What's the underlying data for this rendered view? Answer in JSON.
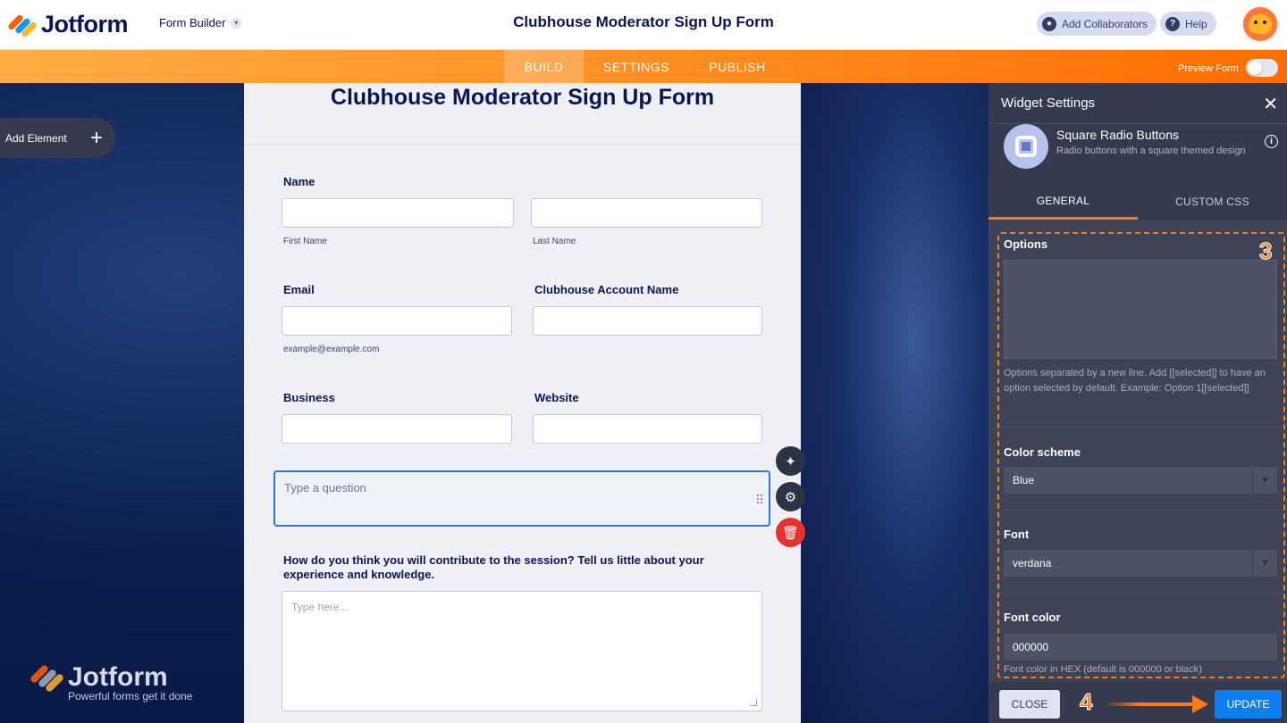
{
  "header": {
    "logo_text": "Jotform",
    "builder_label": "Form Builder",
    "form_title": "Clubhouse Moderator Sign Up Form",
    "add_collaborators": "Add Collaborators",
    "help": "Help"
  },
  "nav": {
    "tabs": [
      "BUILD",
      "SETTINGS",
      "PUBLISH"
    ],
    "active_tab": "BUILD",
    "preview_label": "Preview Form"
  },
  "canvas": {
    "add_element": "Add Element",
    "watermark_text": "Jotform",
    "watermark_tagline": "Powerful forms get it done"
  },
  "form": {
    "heading": "Clubhouse Moderator Sign Up Form",
    "name_label": "Name",
    "first_name_sub": "First Name",
    "last_name_sub": "Last Name",
    "email_label": "Email",
    "email_sub": "example@example.com",
    "clubhouse_label": "Clubhouse Account Name",
    "business_label": "Business",
    "website_label": "Website",
    "question_placeholder": "Type a question",
    "contribute_label": "How do you think you will contribute to the session? Tell us little about your experience and knowledge.",
    "textarea_placeholder": "Type here..."
  },
  "panel": {
    "title": "Widget Settings",
    "widget_name": "Square Radio Buttons",
    "widget_desc": "Radio buttons with a square themed design",
    "tabs": [
      "GENERAL",
      "CUSTOM CSS"
    ],
    "options_label": "Options",
    "options_help": "Options separated by a new line. Add [[selected]] to have an option selected by default. Example: Option 1[[selected]]",
    "color_scheme_label": "Color scheme",
    "color_scheme_value": "Blue",
    "font_label": "Font",
    "font_value": "verdana",
    "font_color_label": "Font color",
    "font_color_value": "000000",
    "font_color_help": "Font color in HEX (default is 000000 or black)",
    "close_button": "CLOSE",
    "update_button": "UPDATE"
  },
  "annotations": {
    "step_3": "3",
    "step_4": "4"
  },
  "colors": {
    "brand_orange": "#ff7a1a",
    "navy": "#0a1551",
    "update_blue": "#0d7ef0",
    "delete_red": "#e5312f"
  },
  "icons": [
    "jotform-logo-icon",
    "chevron-down-icon",
    "user-icon",
    "help-icon",
    "avatar-icon",
    "plus-icon",
    "wand-icon",
    "gear-icon",
    "trash-icon",
    "drag-handle-icon",
    "close-icon",
    "square-radio-icon",
    "info-icon",
    "select-arrow-icon"
  ]
}
